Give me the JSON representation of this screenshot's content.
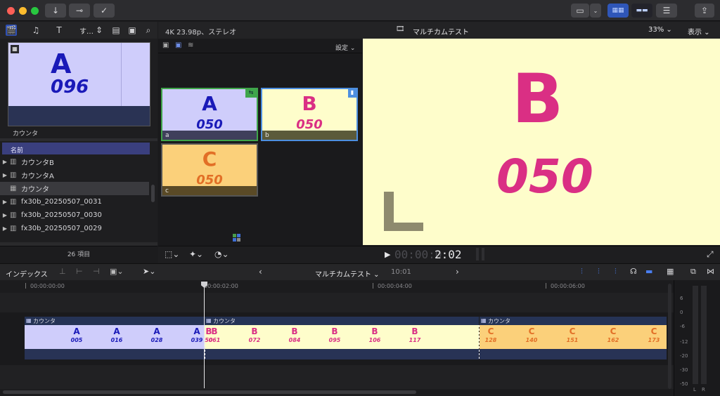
{
  "titlebar": {
    "buttons": [
      "↓",
      "⊸",
      "✓"
    ]
  },
  "browser": {
    "filter_label": "す…",
    "thumb": {
      "letter": "A",
      "number": "096",
      "caption": "カウンタ"
    },
    "column_header": "名前",
    "items": [
      {
        "label": "カウンタB",
        "type": "film",
        "expand": "▶"
      },
      {
        "label": "カウンタA",
        "type": "film",
        "expand": "▶"
      },
      {
        "label": "カウンタ",
        "type": "multicam",
        "expand": ""
      },
      {
        "label": "fx30b_20250507_0031",
        "type": "film",
        "expand": "▶"
      },
      {
        "label": "fx30b_20250507_0030",
        "type": "film",
        "expand": "▶"
      },
      {
        "label": "fx30b_20250507_0029",
        "type": "film",
        "expand": "▶"
      }
    ],
    "item_count": "26 項目"
  },
  "viewer_header": {
    "format": "4K 23.98p、ステレオ",
    "title": "マルチカムテスト",
    "zoom": "33%",
    "view_menu": "表示"
  },
  "angle_viewer": {
    "settings_label": "設定",
    "angles": [
      {
        "letter": "A",
        "number": "050",
        "label": "a",
        "bg": "#cfcdfb",
        "color": "#1a1ab8"
      },
      {
        "letter": "B",
        "number": "050",
        "label": "b",
        "bg": "#fefdcb",
        "color": "#da2f84"
      },
      {
        "letter": "C",
        "number": "050",
        "label": "c",
        "bg": "#fbd07a",
        "color": "#e26f26"
      }
    ]
  },
  "viewer": {
    "letter": "B",
    "number": "050"
  },
  "playback": {
    "timecode_dim": "00:00:0",
    "timecode": "2:02"
  },
  "timeline_toolbar": {
    "index_label": "インデックス",
    "project": "マルチカムテスト",
    "duration": "10:01"
  },
  "ruler": [
    "00:00:00:00",
    "00:00:02:00",
    "00:00:04:00",
    "00:00:06:00"
  ],
  "clips": [
    {
      "name": "カウンタ",
      "letter": "A",
      "color": "#1a1ab8",
      "bg": "#cfcdfb",
      "frames": [
        "005",
        "016",
        "028",
        "039"
      ]
    },
    {
      "name": "カウンタ",
      "letter": "B",
      "color": "#da2f84",
      "bg": "#fefdcb",
      "frames": [
        "061",
        "072",
        "084",
        "095",
        "106",
        "117"
      ],
      "lead": "50"
    },
    {
      "name": "カウンタ",
      "letter": "C",
      "color": "#e26f26",
      "bg": "#fbd07a",
      "frames": [
        "128",
        "140",
        "151",
        "162",
        "173"
      ]
    }
  ],
  "meters": {
    "scale": [
      "6",
      "0",
      "-6",
      "-12",
      "-20",
      "-30",
      "-50"
    ],
    "channels": [
      "L",
      "R"
    ]
  }
}
